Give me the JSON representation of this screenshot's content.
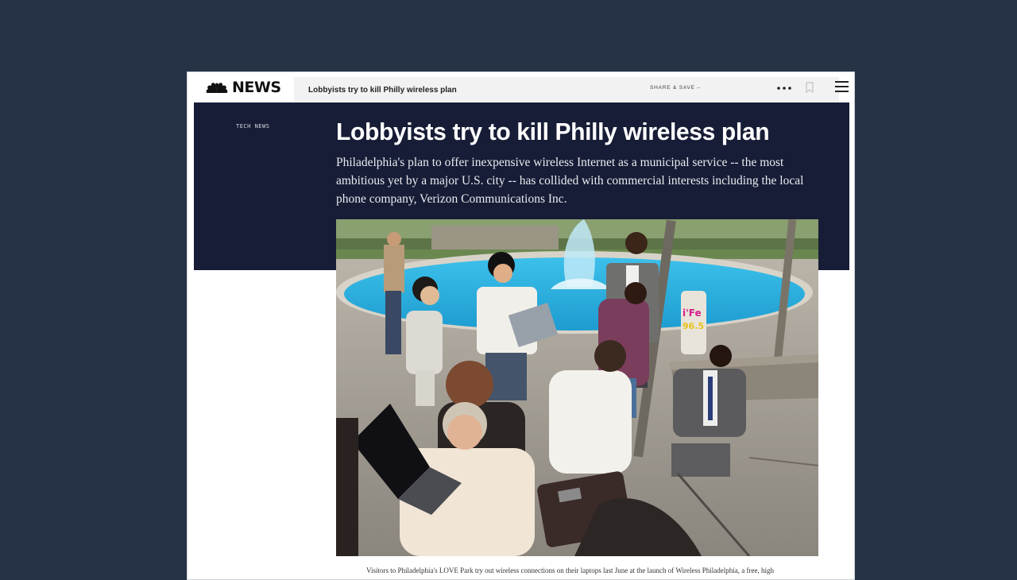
{
  "navbar": {
    "logo_text": "NEWS",
    "article_title": "Lobbyists try to kill Philly wireless plan",
    "share_label": "SHARE & SAVE –",
    "icons": [
      "peacock-logo-icon",
      "facebook-icon",
      "twitter-icon",
      "mail-icon",
      "more-icon",
      "bookmark-icon",
      "menu-icon"
    ]
  },
  "article": {
    "section": "TECH NEWS",
    "headline": "Lobbyists try to kill Philly wireless plan",
    "dek": "Philadelphia's plan to offer inexpensive wireless Internet as a municipal service -- the most ambitious yet by a major U.S. city -- has collided with commercial interests including the local phone company, Verizon Communications Inc.",
    "caption": "Visitors to Philadelphia's LOVE Park try out wireless connections on their laptops last June at the launch of Wireless Philadelphia, a free, high"
  },
  "photo_text": {
    "sign_top": "i'Fe",
    "sign_bottom": "96.5"
  },
  "colors": {
    "page_background": "#263246",
    "hero_background": "#171d36",
    "nav_background": "#f2f2f2",
    "fountain_water": "#2bb0e0"
  }
}
